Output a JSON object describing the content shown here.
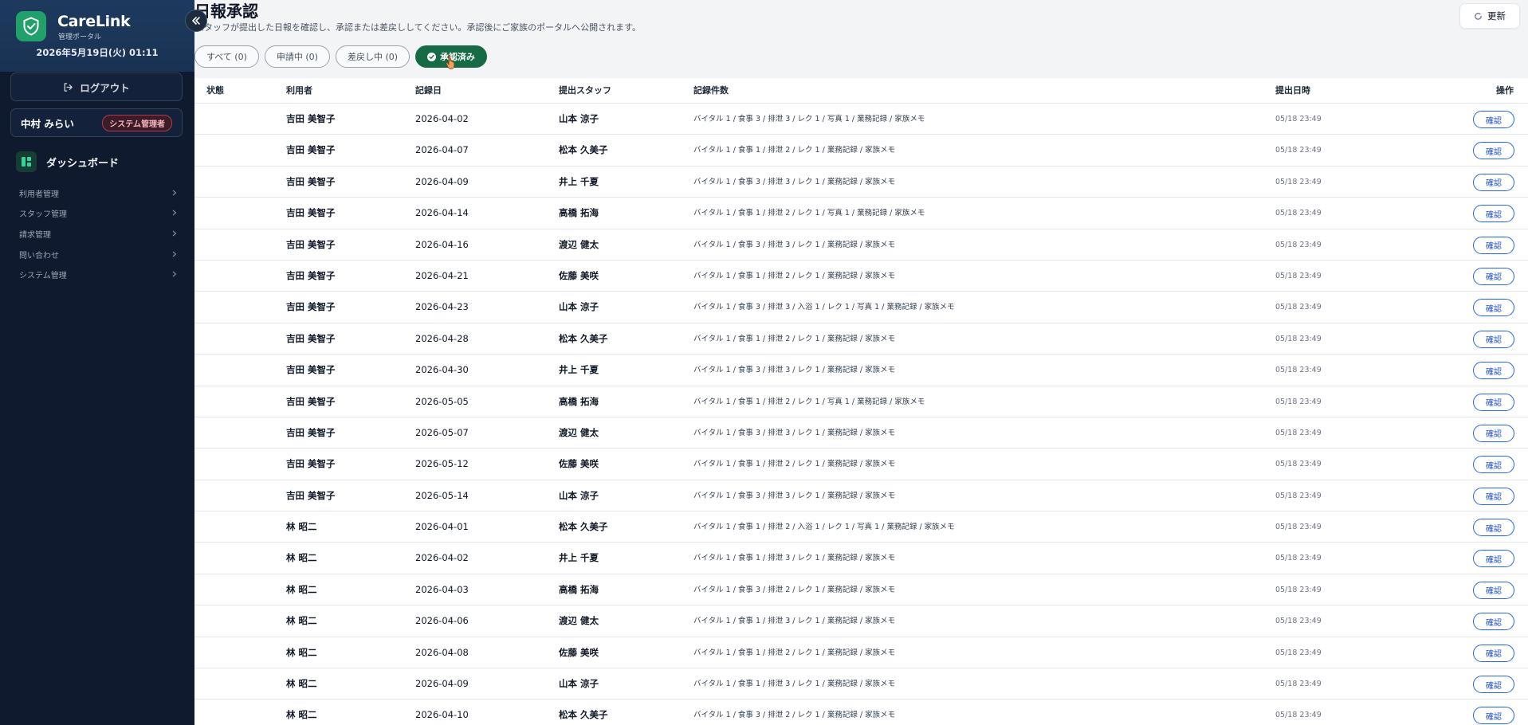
{
  "app": {
    "name": "CareLink",
    "subtitle": "管理ポータル",
    "datetime": "2026年5月19日(火) 01:11"
  },
  "sidebar": {
    "logout_label": "ログアウト",
    "user_name": "中村 みらい",
    "role": "システム管理者",
    "dashboard_label": "ダッシュボード",
    "groups": [
      {
        "label": "利用者管理"
      },
      {
        "label": "スタッフ管理"
      },
      {
        "label": "請求管理"
      },
      {
        "label": "問い合わせ"
      },
      {
        "label": "システム管理"
      }
    ]
  },
  "page": {
    "title": "日報承認",
    "description": "スタッフが提出した日報を確認し、承認または差戻ししてください。承認後にご家族のポータルへ公開されます。",
    "refresh_label": "更新"
  },
  "filters": [
    {
      "label": "すべて (0)",
      "active": false
    },
    {
      "label": "申請中 (0)",
      "active": false
    },
    {
      "label": "差戻し中 (0)",
      "active": false
    },
    {
      "label": "承認済み",
      "active": true
    }
  ],
  "table": {
    "columns": {
      "status": "状態",
      "user": "利用者",
      "date": "記録日",
      "staff": "提出スタッフ",
      "counts": "記録件数",
      "submitted": "提出日時",
      "actions": "操作"
    },
    "action_label": "確認",
    "rows": [
      {
        "user": "吉田 美智子",
        "date": "2026-04-02",
        "staff": "山本 涼子",
        "counts": "バイタル 1 / 食事 3 / 排泄 3 / レク 1 / 写真 1 / 業務記録 / 家族メモ",
        "submitted": "05/18 23:49"
      },
      {
        "user": "吉田 美智子",
        "date": "2026-04-07",
        "staff": "松本 久美子",
        "counts": "バイタル 1 / 食事 1 / 排泄 2 / レク 1 / 業務記録 / 家族メモ",
        "submitted": "05/18 23:49"
      },
      {
        "user": "吉田 美智子",
        "date": "2026-04-09",
        "staff": "井上 千夏",
        "counts": "バイタル 1 / 食事 3 / 排泄 3 / レク 1 / 業務記録 / 家族メモ",
        "submitted": "05/18 23:49"
      },
      {
        "user": "吉田 美智子",
        "date": "2026-04-14",
        "staff": "高橋 拓海",
        "counts": "バイタル 1 / 食事 1 / 排泄 2 / レク 1 / 写真 1 / 業務記録 / 家族メモ",
        "submitted": "05/18 23:49"
      },
      {
        "user": "吉田 美智子",
        "date": "2026-04-16",
        "staff": "渡辺 健太",
        "counts": "バイタル 1 / 食事 3 / 排泄 3 / レク 1 / 業務記録 / 家族メモ",
        "submitted": "05/18 23:49"
      },
      {
        "user": "吉田 美智子",
        "date": "2026-04-21",
        "staff": "佐藤 美咲",
        "counts": "バイタル 1 / 食事 1 / 排泄 2 / レク 1 / 業務記録 / 家族メモ",
        "submitted": "05/18 23:49"
      },
      {
        "user": "吉田 美智子",
        "date": "2026-04-23",
        "staff": "山本 涼子",
        "counts": "バイタル 1 / 食事 3 / 排泄 3 / 入浴 1 / レク 1 / 写真 1 / 業務記録 / 家族メモ",
        "submitted": "05/18 23:49"
      },
      {
        "user": "吉田 美智子",
        "date": "2026-04-28",
        "staff": "松本 久美子",
        "counts": "バイタル 1 / 食事 1 / 排泄 2 / レク 1 / 業務記録 / 家族メモ",
        "submitted": "05/18 23:49"
      },
      {
        "user": "吉田 美智子",
        "date": "2026-04-30",
        "staff": "井上 千夏",
        "counts": "バイタル 1 / 食事 3 / 排泄 3 / レク 1 / 業務記録 / 家族メモ",
        "submitted": "05/18 23:49"
      },
      {
        "user": "吉田 美智子",
        "date": "2026-05-05",
        "staff": "高橋 拓海",
        "counts": "バイタル 1 / 食事 1 / 排泄 2 / レク 1 / 写真 1 / 業務記録 / 家族メモ",
        "submitted": "05/18 23:49"
      },
      {
        "user": "吉田 美智子",
        "date": "2026-05-07",
        "staff": "渡辺 健太",
        "counts": "バイタル 1 / 食事 3 / 排泄 3 / レク 1 / 業務記録 / 家族メモ",
        "submitted": "05/18 23:49"
      },
      {
        "user": "吉田 美智子",
        "date": "2026-05-12",
        "staff": "佐藤 美咲",
        "counts": "バイタル 1 / 食事 1 / 排泄 2 / レク 1 / 業務記録 / 家族メモ",
        "submitted": "05/18 23:49"
      },
      {
        "user": "吉田 美智子",
        "date": "2026-05-14",
        "staff": "山本 涼子",
        "counts": "バイタル 1 / 食事 3 / 排泄 3 / レク 1 / 業務記録 / 家族メモ",
        "submitted": "05/18 23:49"
      },
      {
        "user": "林 昭二",
        "date": "2026-04-01",
        "staff": "松本 久美子",
        "counts": "バイタル 1 / 食事 1 / 排泄 2 / 入浴 1 / レク 1 / 写真 1 / 業務記録 / 家族メモ",
        "submitted": "05/18 23:49"
      },
      {
        "user": "林 昭二",
        "date": "2026-04-02",
        "staff": "井上 千夏",
        "counts": "バイタル 1 / 食事 1 / 排泄 3 / レク 1 / 業務記録 / 家族メモ",
        "submitted": "05/18 23:49"
      },
      {
        "user": "林 昭二",
        "date": "2026-04-03",
        "staff": "高橋 拓海",
        "counts": "バイタル 1 / 食事 3 / 排泄 2 / レク 1 / 業務記録 / 家族メモ",
        "submitted": "05/18 23:49"
      },
      {
        "user": "林 昭二",
        "date": "2026-04-06",
        "staff": "渡辺 健太",
        "counts": "バイタル 1 / 食事 1 / 排泄 3 / レク 1 / 業務記録 / 家族メモ",
        "submitted": "05/18 23:49"
      },
      {
        "user": "林 昭二",
        "date": "2026-04-08",
        "staff": "佐藤 美咲",
        "counts": "バイタル 1 / 食事 1 / 排泄 2 / レク 1 / 業務記録 / 家族メモ",
        "submitted": "05/18 23:49"
      },
      {
        "user": "林 昭二",
        "date": "2026-04-09",
        "staff": "山本 涼子",
        "counts": "バイタル 1 / 食事 1 / 排泄 3 / レク 1 / 業務記録 / 家族メモ",
        "submitted": "05/18 23:49"
      },
      {
        "user": "林 昭二",
        "date": "2026-04-10",
        "staff": "松本 久美子",
        "counts": "バイタル 1 / 食事 3 / 排泄 2 / レク 1 / 業務記録 / 家族メモ",
        "submitted": "05/18 23:49"
      }
    ]
  },
  "colors": {
    "sidebar_bg": "#0f1a2e",
    "brand_green": "#22a06b",
    "active_filter": "#166b45",
    "link_blue": "#2563eb",
    "role_badge": "#b23a48"
  }
}
